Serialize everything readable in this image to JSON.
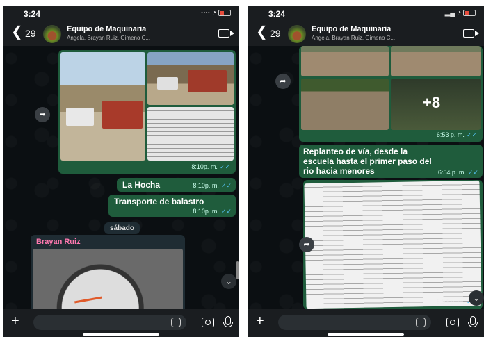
{
  "status": {
    "time": "3:24"
  },
  "header": {
    "back_count": "29",
    "title": "Equipo de Maquinaria",
    "participants": "Angela, Brayan Ruiz, Gimeno C..."
  },
  "left": {
    "album_time": "8:10p. m.",
    "msg1": {
      "text": "La Hocha",
      "time": "8:10p. m."
    },
    "msg2": {
      "text": "Transporte de balastro",
      "time": "8:10p. m."
    },
    "day_separator": "sábado",
    "incoming_sender": "Brayan Ruiz"
  },
  "right": {
    "album_more": "+8",
    "album_time": "6:53 p. m.",
    "caption_lines": [
      "Replanteo de vía, desde la",
      "escuela hasta el primer paso del",
      "rio hacia menores"
    ],
    "caption_time": "6:54 p. m.",
    "image_time": "6:54 p. m."
  },
  "icons": {
    "back": "chevron-left",
    "video": "video-camera",
    "forward": "share-arrow",
    "plus": "plus",
    "sticker": "sticker",
    "camera": "camera",
    "mic": "microphone",
    "read_receipt": "double-check"
  },
  "colors": {
    "outgoing_bubble": "#1f5c3c",
    "incoming_bubble": "#1f2c33",
    "sender_name": "#ff79b0",
    "read_ticks": "#53bdeb"
  }
}
